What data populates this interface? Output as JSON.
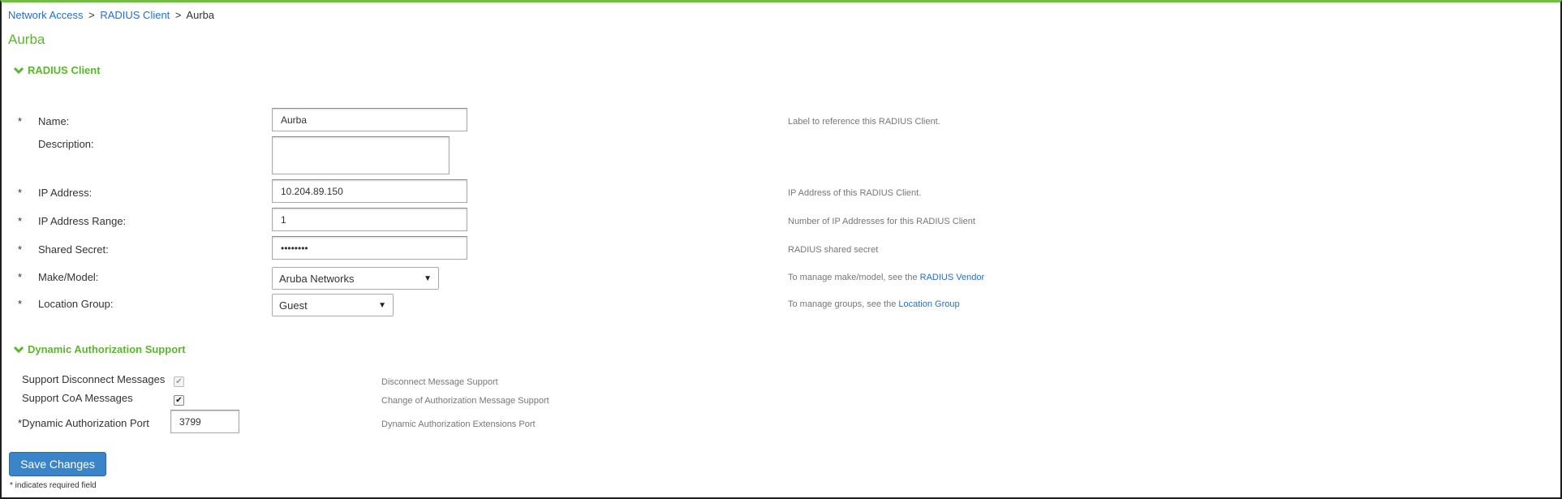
{
  "breadcrumb": {
    "items": [
      "Network Access",
      "RADIUS Client"
    ],
    "separator": ">",
    "current": "Aurba"
  },
  "page_title": "Aurba",
  "radius_section": {
    "title": "RADIUS Client",
    "name": {
      "required": "*",
      "label": "Name:",
      "value": "Aurba",
      "hint": "Label to reference this RADIUS Client."
    },
    "description": {
      "label": "Description:",
      "value": ""
    },
    "ip_address": {
      "required": "*",
      "label": "IP Address:",
      "value": "10.204.89.150",
      "hint": "IP Address of this RADIUS Client."
    },
    "ip_range": {
      "required": "*",
      "label": "IP Address Range:",
      "value": "1",
      "hint": "Number of IP Addresses for this RADIUS Client"
    },
    "shared_secret": {
      "required": "*",
      "label": "Shared Secret:",
      "value": "••••••••",
      "hint": "RADIUS shared secret"
    },
    "make_model": {
      "required": "*",
      "label": "Make/Model:",
      "value": "Aruba Networks",
      "hint": "To manage make/model, see the",
      "link": "RADIUS Vendor"
    },
    "location_group": {
      "required": "*",
      "label": "Location Group:",
      "value": "Guest",
      "hint": "To manage groups, see the",
      "link": "Location Group"
    }
  },
  "dynauth_section": {
    "title": "Dynamic Authorization Support",
    "disconnect": {
      "label": "Support Disconnect Messages",
      "checked": true,
      "disabled": true,
      "hint": "Disconnect Message Support"
    },
    "coa": {
      "label": "Support CoA Messages",
      "checked": true,
      "disabled": false,
      "hint": "Change of Authorization Message Support"
    },
    "port": {
      "label": "*Dynamic Authorization Port",
      "value": "3799",
      "hint": "Dynamic Authorization Extensions Port"
    }
  },
  "save_button": "Save Changes",
  "required_note": "* indicates required field",
  "colors": {
    "accent_green": "#5cb531",
    "link_blue": "#2a6fc1",
    "button_blue": "#3a84c9"
  },
  "icons": {
    "section_toggle": "chevron-down-icon",
    "dropdown": "caret-down-icon",
    "checkbox": "checkmark-icon"
  }
}
